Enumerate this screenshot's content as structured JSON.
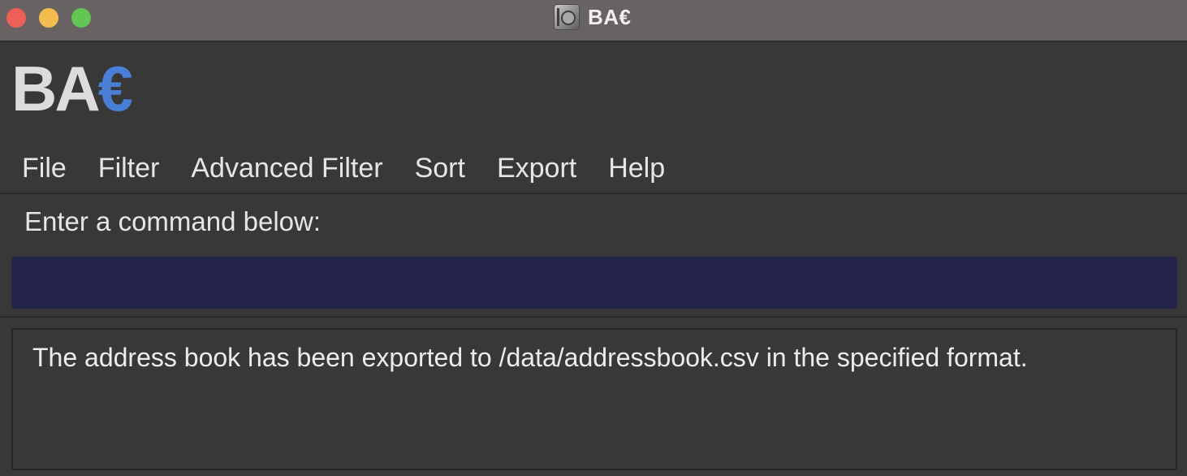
{
  "window": {
    "title": "BA€",
    "controls": {
      "close_color": "#ee5f57",
      "minimize_color": "#f5bd4f",
      "maximize_color": "#62c554"
    },
    "app_icon": "vault-icon"
  },
  "logo": {
    "text_main": "BA",
    "text_accent": "€",
    "main_color": "#dcdcdc",
    "accent_color": "#4a7fd8"
  },
  "menu": {
    "items": [
      {
        "label": "File"
      },
      {
        "label": "Filter"
      },
      {
        "label": "Advanced Filter"
      },
      {
        "label": "Sort"
      },
      {
        "label": "Export"
      },
      {
        "label": "Help"
      }
    ]
  },
  "command": {
    "prompt": "Enter a command below:",
    "value": "",
    "placeholder": "",
    "background_color": "#24244a"
  },
  "result": {
    "message": "The address book has been exported to /data/addressbook.csv in the specified format."
  }
}
